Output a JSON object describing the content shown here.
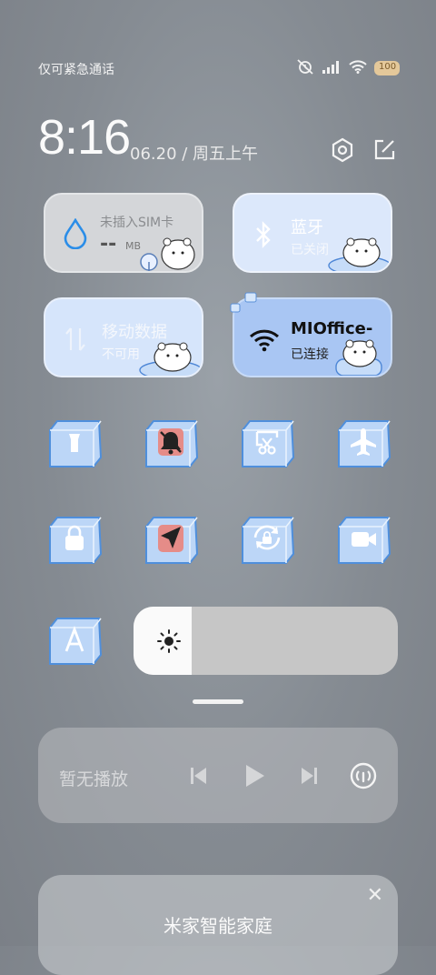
{
  "status_bar": {
    "carrier_text": "仅可紧急通话",
    "battery_text": "100",
    "icons": [
      "alarm-muted-icon",
      "signal-icon",
      "wifi-icon",
      "battery-icon"
    ]
  },
  "header": {
    "time": "8:16",
    "date": "06.20 / 周五上午",
    "icons": [
      "settings-icon",
      "edit-icon"
    ]
  },
  "tiles": {
    "sim": {
      "title": "未插入SIM卡",
      "value": "--",
      "unit": "MB"
    },
    "bluetooth": {
      "title": "蓝牙",
      "status": "已关闭"
    },
    "mobile_data": {
      "title": "移动数据",
      "status": "不可用"
    },
    "wifi": {
      "title": "MIOffice-",
      "status": "已连接"
    }
  },
  "toggles": [
    {
      "name": "flashlight",
      "icon": "flashlight-icon",
      "active": false
    },
    {
      "name": "mute",
      "icon": "bell-off-icon",
      "active": true
    },
    {
      "name": "screenshot",
      "icon": "scissors-icon",
      "active": false
    },
    {
      "name": "airplane",
      "icon": "airplane-icon",
      "active": false
    },
    {
      "name": "lock-screen",
      "icon": "lock-icon",
      "active": false
    },
    {
      "name": "location",
      "icon": "location-arrow-icon",
      "active": true
    },
    {
      "name": "rotation-lock",
      "icon": "rotation-lock-icon",
      "active": false
    },
    {
      "name": "screen-record",
      "icon": "video-camera-icon",
      "active": false
    },
    {
      "name": "font",
      "icon": "font-a-icon",
      "active": false
    }
  ],
  "brightness": {
    "level_percent": 22,
    "icon": "sun-icon"
  },
  "media": {
    "label": "暂无播放",
    "controls": [
      "previous-icon",
      "play-icon",
      "next-icon",
      "cast-icon"
    ]
  },
  "mijia": {
    "title": "米家智能家庭"
  },
  "colors": {
    "ice_blue": "#bcd6f7",
    "ice_edge": "#4f8fdc",
    "active_red": "#e58c88",
    "wifi_tile": "#a9c6f3"
  }
}
